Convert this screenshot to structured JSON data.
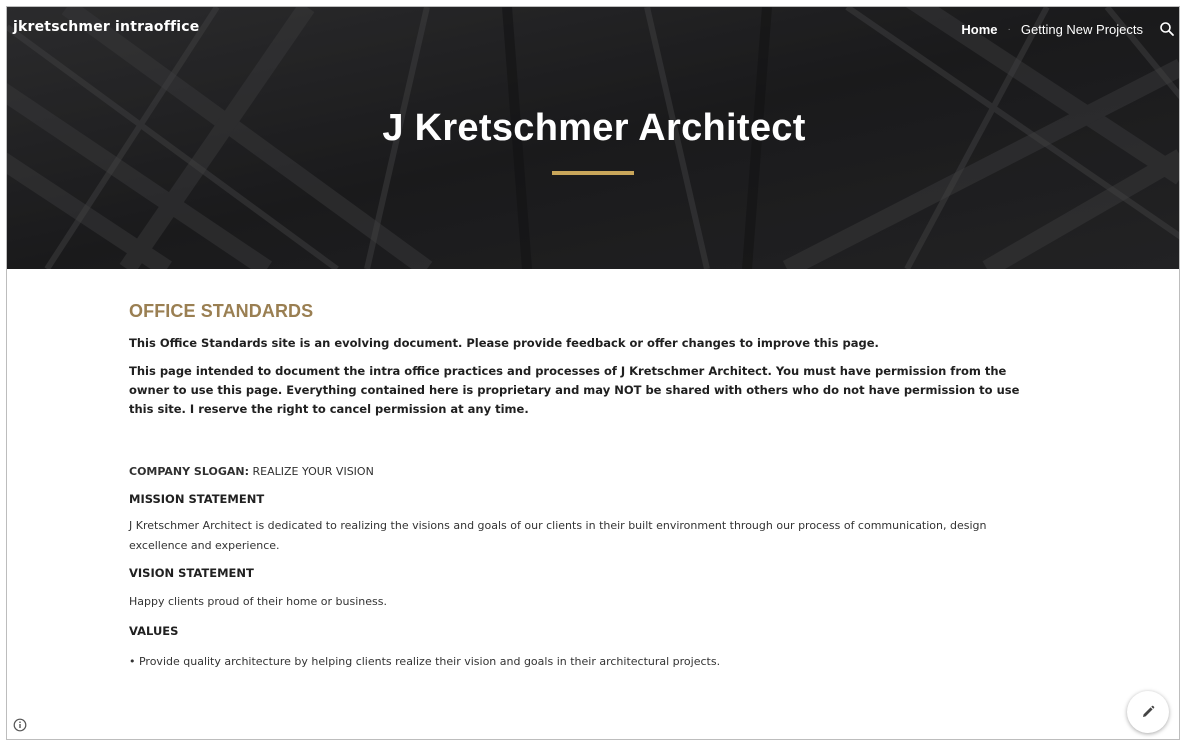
{
  "header": {
    "site_title": "jkretschmer intraoffice",
    "nav": [
      {
        "label": "Home",
        "active": true
      },
      {
        "label": "Getting New Projects",
        "active": false
      }
    ],
    "search_icon": "search-icon",
    "hero_title": "J Kretschmer Architect",
    "accent_color": "#c9a65a"
  },
  "main": {
    "section_heading": "OFFICE STANDARDS",
    "lead_1": "This Office Standards site is an evolving document. Please provide feedback or offer changes to improve this page.",
    "lead_2": "This page intended to document the intra office practices and processes of J Kretschmer Architect. You must have permission from the owner to use this page. Everything contained here is proprietary and may NOT be shared with others who do not have permission to use this site. I reserve the right to cancel permission at any time.",
    "slogan_label": "COMPANY SLOGAN:",
    "slogan_value": " REALIZE YOUR VISION",
    "mission_heading": "MISSION STATEMENT",
    "mission_text": "J Kretschmer Architect is dedicated to realizing the visions and goals of our clients in their built environment through our process of communication, design excellence and experience.",
    "vision_heading": "VISION STATEMENT",
    "vision_text": "Happy clients proud of their home or business.",
    "values_heading": "VALUES",
    "values_items": [
      "• Provide quality architecture by helping clients realize their vision and goals in their architectural projects."
    ]
  },
  "footer": {
    "info_icon": "info-icon",
    "edit_icon": "pencil-icon"
  },
  "colors": {
    "heading": "#9a7f52",
    "hero_bg": "#2c2c2e"
  }
}
